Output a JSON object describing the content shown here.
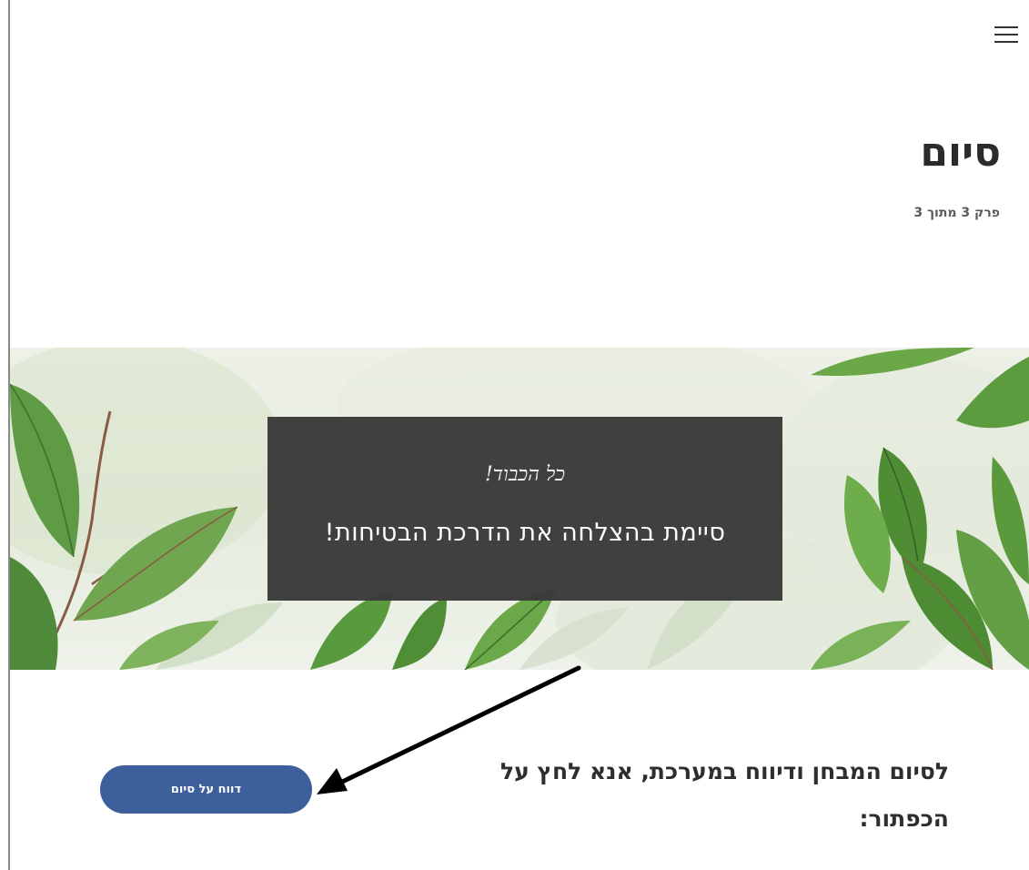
{
  "header": {
    "menu_icon": "hamburger-menu-icon"
  },
  "chapter": {
    "title": "סיום",
    "progress": "פרק 3 מתוך 3"
  },
  "banner": {
    "kudos": "כל הכבוד!",
    "message": "סיימת בהצלחה את הדרכת הבטיחות!",
    "box_color": "#3a3a3a"
  },
  "instruction": {
    "text": "לסיום המבחן ודיווח במערכת, אנא לחץ על הכפתור:"
  },
  "finish_button": {
    "label": "דווח על סיום",
    "color": "#3d5f9b"
  },
  "annotation": {
    "arrow_icon": "black-arrow-icon"
  }
}
